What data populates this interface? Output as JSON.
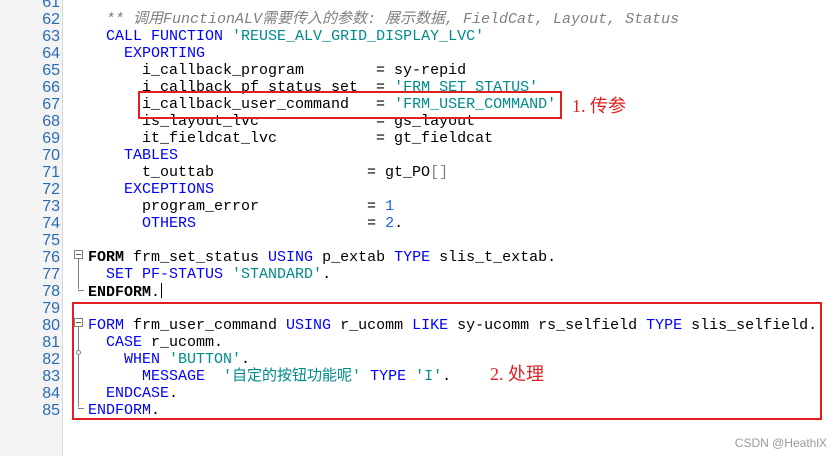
{
  "editor": {
    "lines": [
      {
        "n": "61",
        "parts": []
      },
      {
        "n": "62",
        "parts": [
          {
            "c": "cmt",
            "t": "** 调用FunctionALV需要传入的参数: 展示数据, FieldCat, Layout, Status"
          }
        ],
        "indent": "  "
      },
      {
        "n": "63",
        "parts": [
          {
            "c": "kw",
            "t": "CALL FUNCTION "
          },
          {
            "c": "str",
            "t": "'REUSE_ALV_GRID_DISPLAY_LVC'"
          }
        ],
        "indent": "  "
      },
      {
        "n": "64",
        "parts": [
          {
            "c": "kw",
            "t": "EXPORTING"
          }
        ],
        "indent": "    "
      },
      {
        "n": "65",
        "parts": [
          {
            "c": "",
            "t": "i_callback_program        = sy-repid"
          }
        ],
        "indent": "      "
      },
      {
        "n": "66",
        "parts": [
          {
            "c": "",
            "t": "i_callback_pf_status_set  = "
          },
          {
            "c": "str",
            "t": "'FRM_SET_STATUS'"
          }
        ],
        "indent": "      "
      },
      {
        "n": "67",
        "parts": [
          {
            "c": "",
            "t": "i_callback_user_command   = "
          },
          {
            "c": "str",
            "t": "'FRM_USER_COMMAND'"
          }
        ],
        "indent": "      "
      },
      {
        "n": "68",
        "parts": [
          {
            "c": "",
            "t": "is_layout_lvc             = gs_layout"
          }
        ],
        "indent": "      "
      },
      {
        "n": "69",
        "parts": [
          {
            "c": "",
            "t": "it_fieldcat_lvc           = gt_fieldcat"
          }
        ],
        "indent": "      "
      },
      {
        "n": "70",
        "parts": [
          {
            "c": "kw",
            "t": "TABLES"
          }
        ],
        "indent": "    "
      },
      {
        "n": "71",
        "parts": [
          {
            "c": "",
            "t": "t_outtab                 = gt_PO"
          },
          {
            "c": "gray",
            "t": "[]"
          }
        ],
        "indent": "      "
      },
      {
        "n": "72",
        "parts": [
          {
            "c": "kw",
            "t": "EXCEPTIONS"
          }
        ],
        "indent": "    "
      },
      {
        "n": "73",
        "parts": [
          {
            "c": "",
            "t": "program_error            = "
          },
          {
            "c": "num",
            "t": "1"
          }
        ],
        "indent": "      "
      },
      {
        "n": "74",
        "parts": [
          {
            "c": "kw",
            "t": "OTHERS                   "
          },
          {
            "c": "",
            "t": "= "
          },
          {
            "c": "num",
            "t": "2"
          },
          {
            "c": "",
            "t": "."
          }
        ],
        "indent": "      "
      },
      {
        "n": "75",
        "parts": []
      },
      {
        "n": "76",
        "parts": [
          {
            "c": "kwb",
            "t": "FORM"
          },
          {
            "c": "",
            "t": " frm_set_status "
          },
          {
            "c": "kw",
            "t": "USING"
          },
          {
            "c": "",
            "t": " p_extab "
          },
          {
            "c": "kw",
            "t": "TYPE"
          },
          {
            "c": "",
            "t": " slis_t_extab."
          }
        ],
        "indent": ""
      },
      {
        "n": "77",
        "parts": [
          {
            "c": "kw",
            "t": "SET PF-STATUS "
          },
          {
            "c": "str",
            "t": "'STANDARD'"
          },
          {
            "c": "",
            "t": "."
          }
        ],
        "indent": "  "
      },
      {
        "n": "78",
        "parts": [
          {
            "c": "kwb",
            "t": "ENDFORM"
          },
          {
            "c": "",
            "t": "."
          }
        ],
        "indent": ""
      },
      {
        "n": "79",
        "parts": []
      },
      {
        "n": "80",
        "parts": [
          {
            "c": "kw",
            "t": "FORM"
          },
          {
            "c": "",
            "t": " frm_user_command "
          },
          {
            "c": "kw",
            "t": "USING"
          },
          {
            "c": "",
            "t": " r_ucomm "
          },
          {
            "c": "kw",
            "t": "LIKE"
          },
          {
            "c": "",
            "t": " sy-ucomm rs_selfield "
          },
          {
            "c": "kw",
            "t": "TYPE"
          },
          {
            "c": "",
            "t": " slis_selfield."
          }
        ],
        "indent": ""
      },
      {
        "n": "81",
        "parts": [
          {
            "c": "kw",
            "t": "CASE"
          },
          {
            "c": "",
            "t": " r_ucomm."
          }
        ],
        "indent": "  "
      },
      {
        "n": "82",
        "parts": [
          {
            "c": "kw",
            "t": "WHEN "
          },
          {
            "c": "str",
            "t": "'BUTTON'"
          },
          {
            "c": "",
            "t": "."
          }
        ],
        "indent": "    "
      },
      {
        "n": "83",
        "parts": [
          {
            "c": "kw",
            "t": "MESSAGE  "
          },
          {
            "c": "str",
            "t": "'自定的按钮功能呢'"
          },
          {
            "c": "",
            "t": " "
          },
          {
            "c": "kw",
            "t": "TYPE "
          },
          {
            "c": "str",
            "t": "'I'"
          },
          {
            "c": "",
            "t": "."
          }
        ],
        "indent": "      "
      },
      {
        "n": "84",
        "parts": [
          {
            "c": "kw",
            "t": "ENDCASE"
          },
          {
            "c": "",
            "t": "."
          }
        ],
        "indent": "  "
      },
      {
        "n": "85",
        "parts": [
          {
            "c": "kw",
            "t": "ENDFORM"
          },
          {
            "c": "",
            "t": "."
          }
        ],
        "indent": ""
      }
    ]
  },
  "annotations": {
    "label_1": "1. 传参",
    "label_2": "2. 处理"
  },
  "watermark": "CSDN @HeathlX",
  "colors": {
    "highlight": "#e0201f",
    "keyword": "#0000ff",
    "string": "#008b8b",
    "comment": "#808080"
  }
}
